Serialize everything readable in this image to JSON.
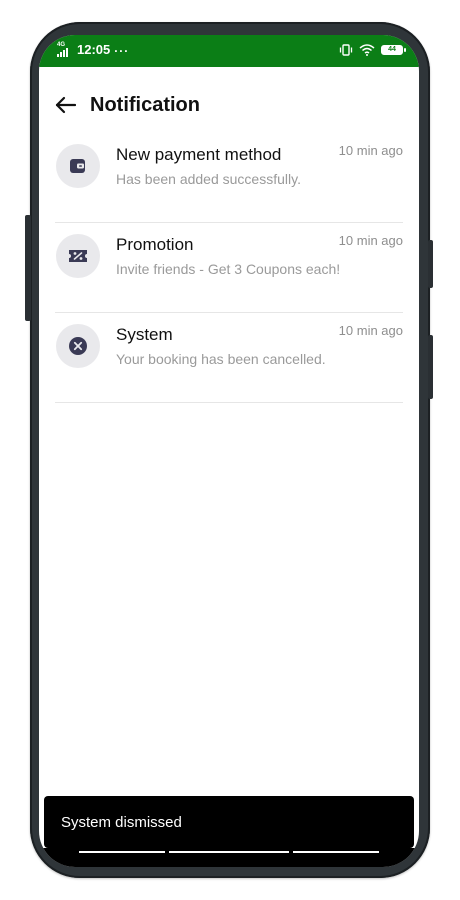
{
  "status_bar": {
    "network": "4G",
    "time": "12:05",
    "more": "···",
    "battery": "44",
    "background_color": "#0b7e16"
  },
  "header": {
    "title": "Notification",
    "back_icon": "arrow-left-icon"
  },
  "notifications": [
    {
      "icon": "wallet-icon",
      "title": "New payment method",
      "time": "10 min ago",
      "body": "Has been added successfully."
    },
    {
      "icon": "coupon-icon",
      "title": "Promotion",
      "time": "10 min ago",
      "body": "Invite friends - Get 3 Coupons each!"
    },
    {
      "icon": "cancel-circle-icon",
      "title": "System",
      "time": "10 min ago",
      "body": "Your booking has been cancelled."
    }
  ],
  "snackbar": {
    "message": "System dismissed"
  },
  "colors": {
    "icon_fill": "#3a3a55",
    "icon_bg": "#e9e9ec",
    "title": "#111111",
    "muted": "#9a9a9a"
  }
}
